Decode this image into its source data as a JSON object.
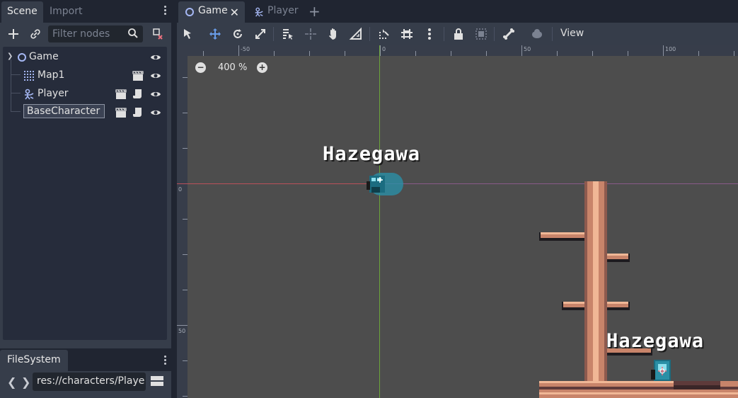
{
  "left_dock": {
    "tabs": [
      {
        "label": "Scene",
        "active": true
      },
      {
        "label": "Import",
        "active": false
      }
    ],
    "filter_placeholder": "Filter nodes",
    "tree": [
      {
        "label": "Game",
        "icon": "node2d-icon",
        "expanded": true
      },
      {
        "label": "Map1",
        "icon": "tilemap-icon"
      },
      {
        "label": "Player",
        "icon": "kinematic-body-icon"
      },
      {
        "label": "BaseCharacter",
        "icon": "kinematic-body-icon",
        "selected": true
      }
    ]
  },
  "filesystem": {
    "tab_label": "FileSystem",
    "path": "res://characters/Playe"
  },
  "scene_tabs": [
    {
      "label": "Game",
      "active": true
    },
    {
      "label": "Player",
      "active": false
    }
  ],
  "toolbar": {
    "view_label": "View"
  },
  "viewport": {
    "zoom": "400 %",
    "ruler_top": [
      "-50",
      "0",
      "50",
      "100"
    ],
    "ruler_left": [
      "0",
      "50"
    ],
    "name_labels": [
      "Hazegawa",
      "Hazegawa"
    ]
  },
  "colors": {
    "accent": "#699ce8",
    "x_axis": "#b9505a",
    "y_axis": "#6ca43a",
    "viewport_bg": "#4d4d4d",
    "panel_bg": "#363d4a"
  }
}
